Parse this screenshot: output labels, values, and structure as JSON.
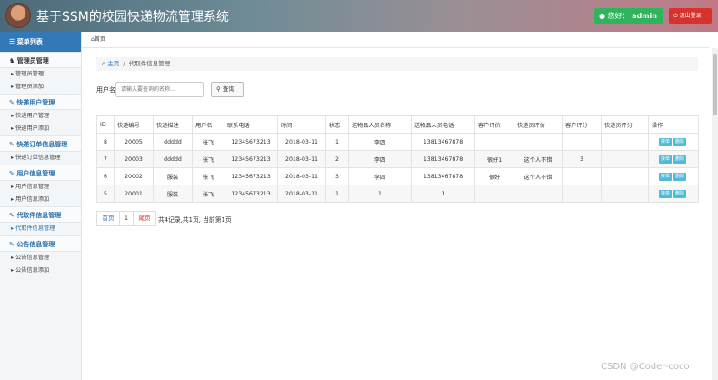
{
  "header": {
    "title": "基于SSM的校园快递物流管理系统",
    "greeting": "您好：",
    "username": "admin",
    "logout_label": "退出登录"
  },
  "sidebar": {
    "heading": "菜单列表",
    "groups": [
      {
        "label": "管理员管理",
        "items": [
          "管理员管理",
          "管理员添加"
        ]
      },
      {
        "label": "快递用户管理",
        "items": [
          "快递用户管理",
          "快递用户添加"
        ]
      },
      {
        "label": "快递订单信息管理",
        "items": [
          "快递订单信息管理"
        ]
      },
      {
        "label": "用户信息管理",
        "items": [
          "用户信息管理",
          "用户信息添加"
        ]
      },
      {
        "label": "代取件信息管理",
        "items": [
          "代取件信息管理"
        ]
      },
      {
        "label": "公告信息管理",
        "items": [
          "公告信息管理",
          "公告信息添加"
        ]
      }
    ]
  },
  "tab": {
    "label": "首页"
  },
  "breadcrumb": {
    "home": "主页",
    "current": "代取件信息管理"
  },
  "search": {
    "label": "用户名",
    "placeholder": "请输入要查询的名称...",
    "button_label": "查询"
  },
  "table": {
    "columns": [
      "ID",
      "快递编号",
      "快递描述",
      "用户名",
      "联系电话",
      "时间",
      "状态",
      "送物品人员名称",
      "送物品人员电话",
      "客户评价",
      "快递员评价",
      "客户评分",
      "快递员评分",
      "操作"
    ],
    "rows": [
      [
        "8",
        "20005",
        "ddddd",
        "张飞",
        "12345673213",
        "2018-03-11",
        "1",
        "李四",
        "13813467878",
        "",
        "",
        "",
        ""
      ],
      [
        "7",
        "20003",
        "ddddd",
        "张飞",
        "12345673213",
        "2018-03-11",
        "2",
        "李四",
        "13813467878",
        "很好1",
        "这个人不错",
        "3",
        ""
      ],
      [
        "6",
        "20002",
        "服装",
        "张飞",
        "12345673213",
        "2018-03-11",
        "3",
        "李四",
        "13813467878",
        "很好",
        "这个人不错",
        "",
        ""
      ],
      [
        "5",
        "20001",
        "服装",
        "张飞",
        "12345673213",
        "2018-03-11",
        "1",
        "1",
        "1",
        "",
        "",
        "",
        ""
      ]
    ],
    "actions": [
      "接单",
      "删除"
    ]
  },
  "pager": {
    "first": "首页",
    "page": "1",
    "last": "尾页",
    "info": "共4记录,共1页, 当前第1页"
  },
  "watermark": "CSDN @Coder-coco"
}
